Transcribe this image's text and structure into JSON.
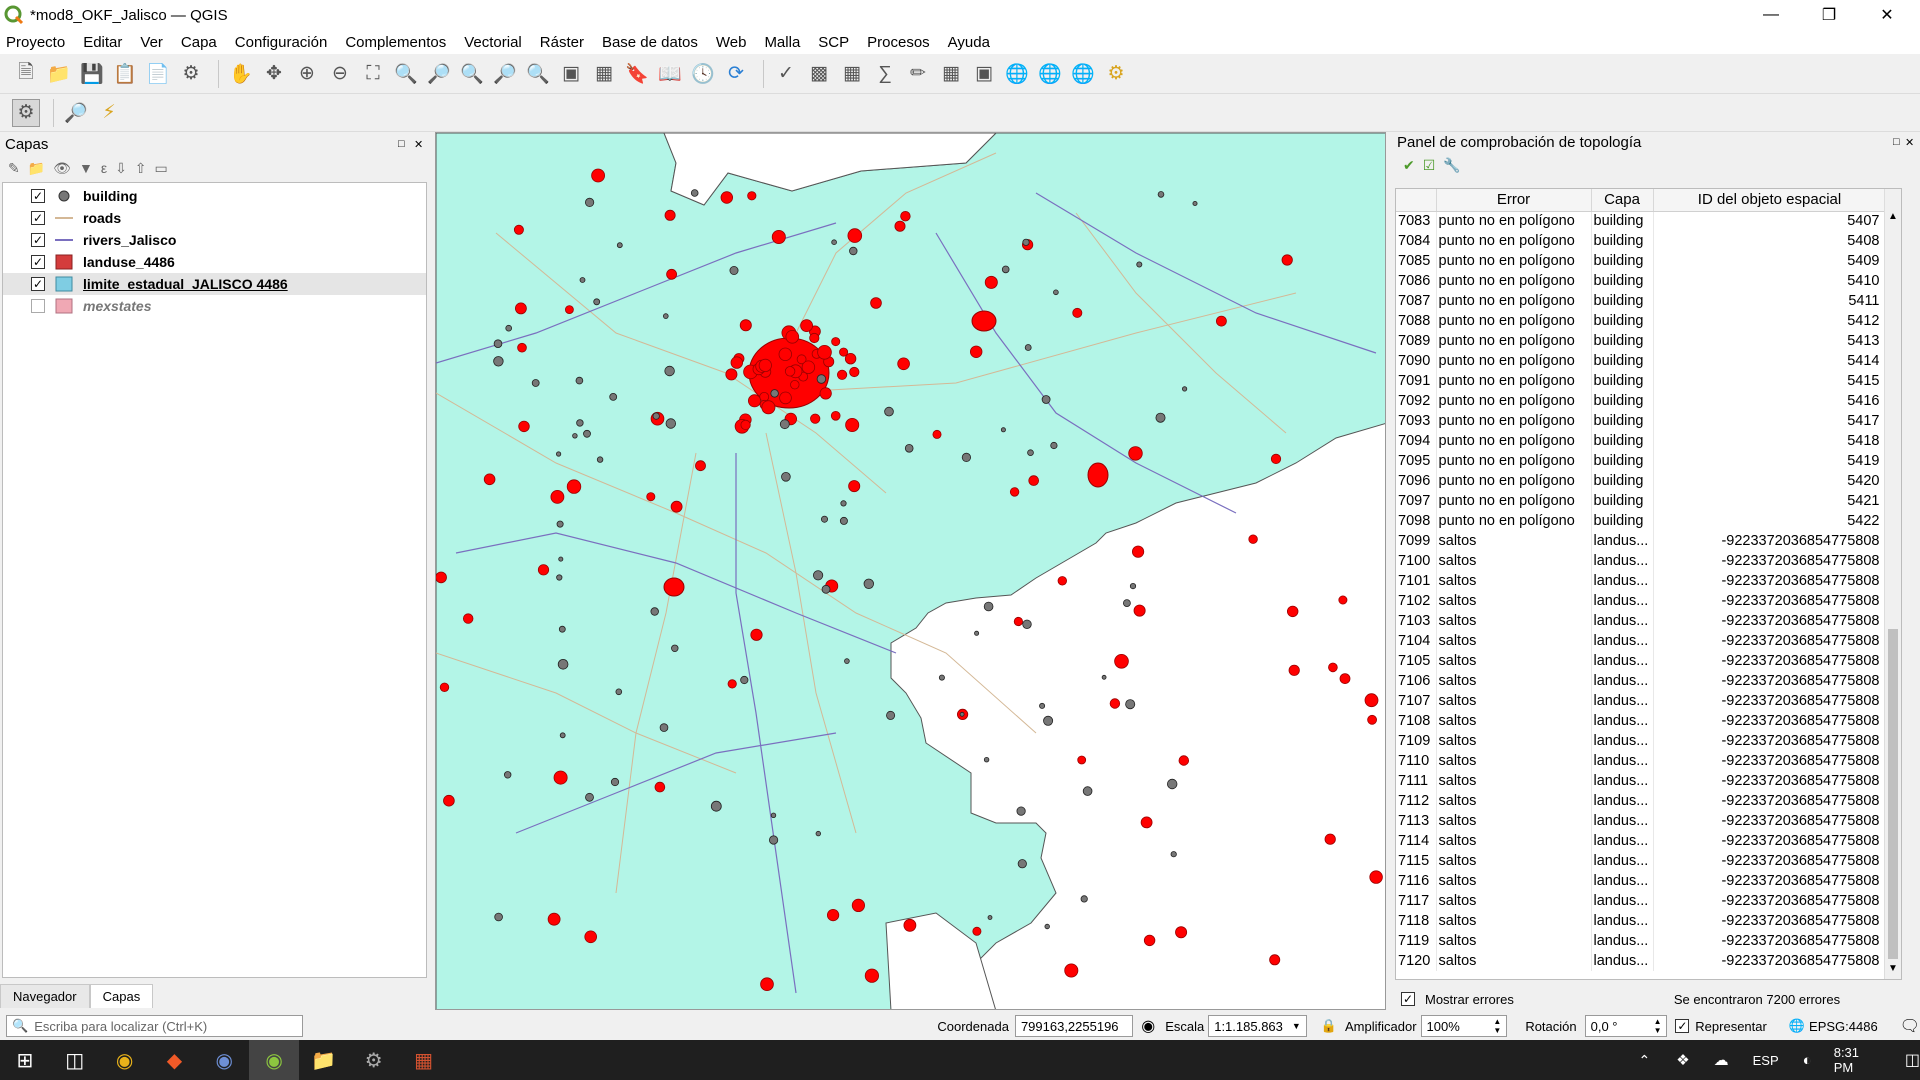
{
  "window": {
    "title": "*mod8_OKF_Jalisco — QGIS"
  },
  "menu": [
    "Proyecto",
    "Editar",
    "Ver",
    "Capa",
    "Configuración",
    "Complementos",
    "Vectorial",
    "Ráster",
    "Base de datos",
    "Web",
    "Malla",
    "SCP",
    "Procesos",
    "Ayuda"
  ],
  "layers_panel": {
    "title": "Capas",
    "layers": [
      {
        "name": "building",
        "checked": true,
        "symbol": "point-gray"
      },
      {
        "name": "roads",
        "checked": true,
        "symbol": "line-tan"
      },
      {
        "name": "rivers_Jalisco",
        "checked": true,
        "symbol": "line-purple"
      },
      {
        "name": "landuse_4486",
        "checked": true,
        "symbol": "fill-red"
      },
      {
        "name": "limite_estadual_JALISCO 4486",
        "checked": true,
        "symbol": "fill-cyan"
      },
      {
        "name": "mexstates",
        "checked": false,
        "symbol": "fill-pink"
      }
    ],
    "tabs": [
      "Navegador",
      "Capas"
    ]
  },
  "topology_panel": {
    "title": "Panel de comprobación de topología",
    "columns": [
      "Error",
      "Capa",
      "ID del objeto espacial"
    ],
    "rows": [
      [
        "7083",
        "punto no en polígono",
        "building",
        "5407"
      ],
      [
        "7084",
        "punto no en polígono",
        "building",
        "5408"
      ],
      [
        "7085",
        "punto no en polígono",
        "building",
        "5409"
      ],
      [
        "7086",
        "punto no en polígono",
        "building",
        "5410"
      ],
      [
        "7087",
        "punto no en polígono",
        "building",
        "5411"
      ],
      [
        "7088",
        "punto no en polígono",
        "building",
        "5412"
      ],
      [
        "7089",
        "punto no en polígono",
        "building",
        "5413"
      ],
      [
        "7090",
        "punto no en polígono",
        "building",
        "5414"
      ],
      [
        "7091",
        "punto no en polígono",
        "building",
        "5415"
      ],
      [
        "7092",
        "punto no en polígono",
        "building",
        "5416"
      ],
      [
        "7093",
        "punto no en polígono",
        "building",
        "5417"
      ],
      [
        "7094",
        "punto no en polígono",
        "building",
        "5418"
      ],
      [
        "7095",
        "punto no en polígono",
        "building",
        "5419"
      ],
      [
        "7096",
        "punto no en polígono",
        "building",
        "5420"
      ],
      [
        "7097",
        "punto no en polígono",
        "building",
        "5421"
      ],
      [
        "7098",
        "punto no en polígono",
        "building",
        "5422"
      ],
      [
        "7099",
        "saltos",
        "landus...",
        "-9223372036854775808"
      ],
      [
        "7100",
        "saltos",
        "landus...",
        "-9223372036854775808"
      ],
      [
        "7101",
        "saltos",
        "landus...",
        "-9223372036854775808"
      ],
      [
        "7102",
        "saltos",
        "landus...",
        "-9223372036854775808"
      ],
      [
        "7103",
        "saltos",
        "landus...",
        "-9223372036854775808"
      ],
      [
        "7104",
        "saltos",
        "landus...",
        "-9223372036854775808"
      ],
      [
        "7105",
        "saltos",
        "landus...",
        "-9223372036854775808"
      ],
      [
        "7106",
        "saltos",
        "landus...",
        "-9223372036854775808"
      ],
      [
        "7107",
        "saltos",
        "landus...",
        "-9223372036854775808"
      ],
      [
        "7108",
        "saltos",
        "landus...",
        "-9223372036854775808"
      ],
      [
        "7109",
        "saltos",
        "landus...",
        "-9223372036854775808"
      ],
      [
        "7110",
        "saltos",
        "landus...",
        "-9223372036854775808"
      ],
      [
        "7111",
        "saltos",
        "landus...",
        "-9223372036854775808"
      ],
      [
        "7112",
        "saltos",
        "landus...",
        "-9223372036854775808"
      ],
      [
        "7113",
        "saltos",
        "landus...",
        "-9223372036854775808"
      ],
      [
        "7114",
        "saltos",
        "landus...",
        "-9223372036854775808"
      ],
      [
        "7115",
        "saltos",
        "landus...",
        "-9223372036854775808"
      ],
      [
        "7116",
        "saltos",
        "landus...",
        "-9223372036854775808"
      ],
      [
        "7117",
        "saltos",
        "landus...",
        "-9223372036854775808"
      ],
      [
        "7118",
        "saltos",
        "landus...",
        "-9223372036854775808"
      ],
      [
        "7119",
        "saltos",
        "landus...",
        "-9223372036854775808"
      ],
      [
        "7120",
        "saltos",
        "landus...",
        "-9223372036854775808"
      ]
    ],
    "show_errors_label": "Mostrar errores",
    "found_label": "Se encontraron 7200 errores"
  },
  "statusbar": {
    "search_placeholder": "Escriba para localizar (Ctrl+K)",
    "coord_label": "Coordenada",
    "coord_value": "799163,2255196",
    "scale_label": "Escala",
    "scale_value": "1:1.185.863",
    "magnifier_label": "Amplificador",
    "magnifier_value": "100%",
    "rotation_label": "Rotación",
    "rotation_value": "0,0 °",
    "render_label": "Representar",
    "crs": "EPSG:4486"
  },
  "taskbar": {
    "lang": "ESP",
    "time": "8:31 PM"
  },
  "colors": {
    "map_fill": "#b3f5e7",
    "point_red": "#ff0000",
    "point_gray": "#777777",
    "roads": "#d4b896",
    "rivers": "#7a6fbf"
  }
}
